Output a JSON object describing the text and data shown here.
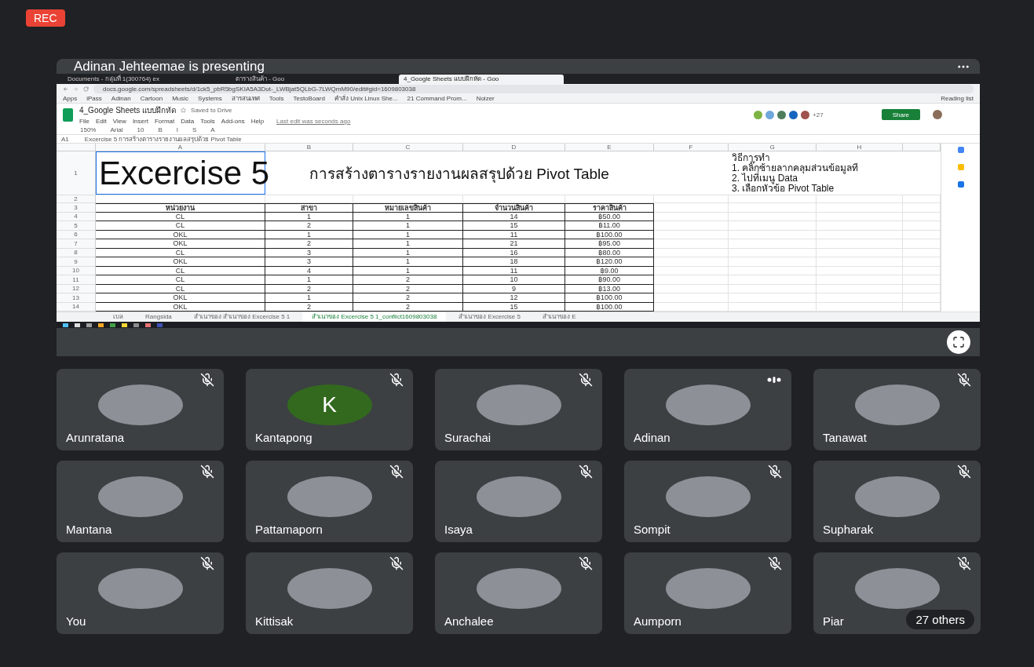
{
  "recording": {
    "label": "REC"
  },
  "presentation": {
    "title": "Adinan Jehteemae is presenting",
    "browser": {
      "tabs": [
        {
          "title": "Documents - กลุ่มที่ 1(300764) ex",
          "selected": false
        },
        {
          "title": "ตารางสินค้า - Goo",
          "selected": false
        },
        {
          "title": "4_Google Sheets แบบฝึกหัด - Goo",
          "selected": true
        }
      ],
      "url": "docs.google.com/spreadsheets/d/1ck5_pbR5bgSKIA5A3Dut-_LWBjat5QLbG-7LWQmM90/edit#gid=1609803038",
      "bookmarks": [
        "Apps",
        "iPass",
        "Adinan",
        "Cartoon",
        "Music",
        "Systems",
        "สารสนเทศ",
        "Tools",
        "TestoBoard",
        "คำสั่ง Unix Linux She...",
        "21 Command Prom...",
        "Noizer"
      ],
      "reading_list": "Reading list"
    },
    "doc": {
      "title": "4_Google Sheets แบบฝึกหัด",
      "saved": "Saved to Drive",
      "menu": [
        "File",
        "Edit",
        "View",
        "Insert",
        "Format",
        "Data",
        "Tools",
        "Add-ons",
        "Help"
      ],
      "last_edit": "Last edit was seconds ago",
      "collaborator_count": "+27",
      "share": "Share",
      "toolbar": [
        "150%",
        "Arial",
        "10",
        "B",
        "I",
        "S",
        "A"
      ]
    },
    "formula_bar": {
      "cell": "A1",
      "content": "Excercise 5  การสร้างตารางรายงานผลสรุปด้วย Pivot Table"
    },
    "sheet": {
      "columns": [
        "A",
        "B",
        "C",
        "D",
        "E",
        "F",
        "G",
        "H"
      ],
      "row_numbers": [
        "1",
        "2",
        "3",
        "4",
        "5",
        "6",
        "7",
        "8",
        "9",
        "10",
        "11",
        "12",
        "13",
        "14"
      ],
      "title": "Excercise 5",
      "subtitle": "การสร้างตารางรายงานผลสรุปด้วย Pivot Table",
      "instructions": [
        "วิธีการทำ",
        "1. คลิ๊กซ้ายลากคลุมส่วนข้อมูลที",
        "2. ไปที่เมนู Data",
        "3. เลือกหัวข้อ Pivot Table"
      ],
      "header": [
        "หน่วยงาน",
        "สาขา",
        "หมายเลขสินค้า",
        "จำนวนสินค้า",
        "ราคาสินค้า"
      ],
      "rows": [
        [
          "CL",
          "1",
          "1",
          "14",
          "฿50.00"
        ],
        [
          "CL",
          "2",
          "1",
          "15",
          "฿11.00"
        ],
        [
          "OKL",
          "1",
          "1",
          "11",
          "฿100.00"
        ],
        [
          "OKL",
          "2",
          "1",
          "21",
          "฿95.00"
        ],
        [
          "CL",
          "3",
          "1",
          "16",
          "฿80.00"
        ],
        [
          "OKL",
          "3",
          "1",
          "18",
          "฿120.00"
        ],
        [
          "CL",
          "4",
          "1",
          "11",
          "฿9.00"
        ],
        [
          "CL",
          "1",
          "2",
          "10",
          "฿90.00"
        ],
        [
          "CL",
          "2",
          "2",
          "9",
          "฿13.00"
        ],
        [
          "OKL",
          "1",
          "2",
          "12",
          "฿100.00"
        ],
        [
          "OKL",
          "2",
          "2",
          "15",
          "฿100.00"
        ]
      ]
    },
    "sheet_tabs": [
      {
        "label": "เบล",
        "selected": false
      },
      {
        "label": "Rangsida",
        "selected": false
      },
      {
        "label": "สำเนาของ สำเนาของ Excercise 5 1",
        "selected": false
      },
      {
        "label": "สำเนาของ Excercise 5 1_conflict1609803038",
        "selected": true
      },
      {
        "label": "สำเนาของ Excercise 5",
        "selected": false
      },
      {
        "label": "สำเนาของ E",
        "selected": false
      }
    ]
  },
  "participants": [
    {
      "name": "Arunratana",
      "kind": "photo",
      "muted": true
    },
    {
      "name": "Kantapong",
      "kind": "letter",
      "initial": "K",
      "muted": true
    },
    {
      "name": "Surachai",
      "kind": "photo",
      "muted": true
    },
    {
      "name": "Adinan",
      "kind": "photo",
      "muted": false
    },
    {
      "name": "Tanawat",
      "kind": "photo",
      "muted": true
    },
    {
      "name": "Mantana",
      "kind": "photo",
      "muted": true
    },
    {
      "name": "Pattamaporn",
      "kind": "photo",
      "muted": true
    },
    {
      "name": "Isaya",
      "kind": "photo",
      "muted": true
    },
    {
      "name": "Sompit",
      "kind": "photo",
      "muted": true
    },
    {
      "name": "Supharak",
      "kind": "photo",
      "muted": true
    },
    {
      "name": "You",
      "kind": "photo",
      "muted": true
    },
    {
      "name": "Kittisak",
      "kind": "photo",
      "muted": true
    },
    {
      "name": "Anchalee",
      "kind": "photo",
      "muted": true
    },
    {
      "name": "Aumporn",
      "kind": "photo",
      "muted": true
    },
    {
      "name": "Piar",
      "kind": "photo",
      "muted": true
    }
  ],
  "others": {
    "label": "27 others"
  }
}
